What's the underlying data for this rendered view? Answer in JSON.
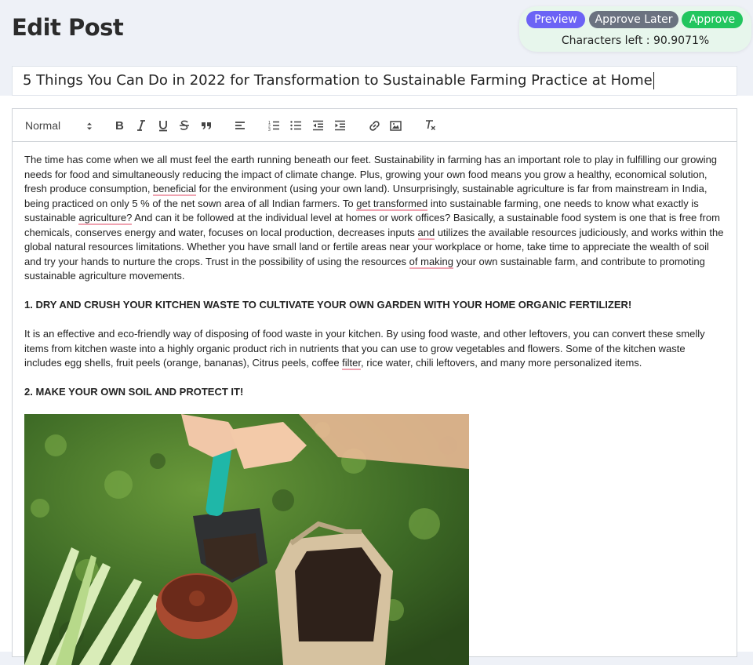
{
  "header": {
    "title": "Edit Post"
  },
  "actions": {
    "preview_label": "Preview",
    "approve_later_label": "Approve Later",
    "approve_label": "Approve",
    "characters_left": "Characters left : 90.9071%"
  },
  "post": {
    "title": "5 Things You Can Do in 2022 for Transformation to Sustainable Farming Practice at Home"
  },
  "toolbar": {
    "format_value": "Normal",
    "icons": [
      "bold-icon",
      "italic-icon",
      "underline-icon",
      "strike-icon",
      "blockquote-icon",
      "align-left-icon",
      "ordered-list-icon",
      "bullet-list-icon",
      "outdent-icon",
      "indent-icon",
      "link-icon",
      "image-icon",
      "clear-format-icon"
    ]
  },
  "content": {
    "p1": [
      "The time has come when we all must feel the earth running beneath our feet. Sustainability in farming has an important role to play in fulfilling our growing needs for food and simultaneously reducing the impact of climate change. Plus, growing your own food means you grow a healthy, economical solution, fresh produce consumption, ",
      "beneficial",
      " for the environment (using your own land). Unsurprisingly, sustainable agriculture is far from mainstream in India, being practiced on only 5 % of the net sown area of all Indian farmers. To ",
      "get transformed",
      " into sustainable farming, one needs to know what exactly is sustainable ",
      "agriculture?",
      " And can it be followed at the individual level at homes or work offices? Basically, a sustainable food system is one that is free from chemicals, conserves energy and water, focuses on local production, decreases inputs ",
      "and",
      " utilizes the available resources judiciously, and works within the global natural resources limitations. Whether you have small land or fertile areas near your workplace or home, take time to appreciate the wealth of soil and try your hands to nurture the crops. Trust in the possibility of using the resources ",
      "of making",
      " your own sustainable farm, and contribute to promoting sustainable agriculture movements."
    ],
    "h1": "1. DRY AND CRUSH YOUR KITCHEN WASTE TO CULTIVATE YOUR OWN GARDEN WITH YOUR HOME ORGANIC FERTILIZER!",
    "p2": [
      "It is an effective and eco-friendly way of disposing of food waste in your kitchen. By using food waste, and other leftovers, you can convert these smelly items from kitchen waste into a highly organic product rich in nutrients that you can use to grow vegetables and flowers. Some of the kitchen waste includes egg shells, fruit peels (orange, bananas), Citrus peels, coffee ",
      "filter",
      ", rice water, chili leftovers, and many more personalized items."
    ],
    "h2": "2. MAKE YOUR OWN SOIL AND PROTECT IT!"
  },
  "colors": {
    "preview": "#6c63f5",
    "approve_later": "#6b7280",
    "approve": "#22c55e",
    "spell_underline": "#f0a3b1"
  }
}
